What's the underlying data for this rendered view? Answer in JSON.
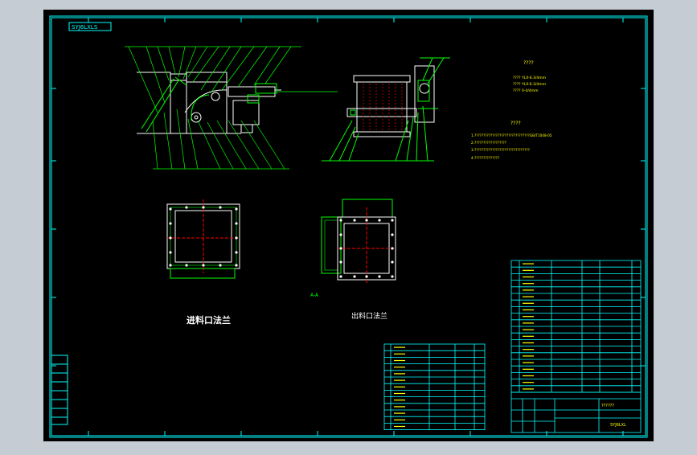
{
  "title_stamp": "SYJ6LXLS",
  "drawing_code": "SYJ6LXL",
  "section_label": "A-A",
  "inlet_flange_label": "进料口法兰",
  "outlet_flange_label": "出料口法兰",
  "spec_title": "????",
  "spec_lines": [
    "????    YLX-6.3/4mm",
    "????    YLX-6.3/4mm",
    "????    0-4/4mm"
  ],
  "tech_title": "????",
  "tech_lines": [
    "1.???????????????????????????????GB/T1048-05",
    "2.??????????????????",
    "3.???????????????????????????????",
    "4.??????????????"
  ],
  "title_block_name": "??????",
  "colors": {
    "background": "#000000",
    "frame": "#00ffff",
    "lines": "#ffffff",
    "annotations": "#00ff00",
    "hidden": "#ff0000",
    "text": "#ffff00"
  }
}
